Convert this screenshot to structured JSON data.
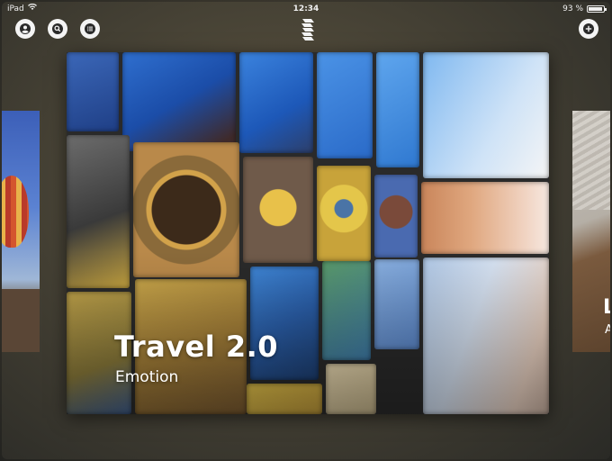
{
  "status_bar": {
    "device": "iPad",
    "time": "12:34",
    "battery_text": "93 %",
    "battery_level": 0.93
  },
  "toolbar": {
    "profile_icon": "person-icon",
    "search_icon": "search-icon",
    "menu_icon": "list-icon",
    "add_icon": "plus-icon",
    "logo_icon": "storehouse-logo"
  },
  "cards": {
    "main": {
      "title": "Travel 2.0",
      "subtitle": "Emotion"
    },
    "right_peek": {
      "title_fragment": "L",
      "subtitle_fragment": "A"
    }
  },
  "colors": {
    "button_bg": "#f4f4f4",
    "text": "#ffffff"
  }
}
